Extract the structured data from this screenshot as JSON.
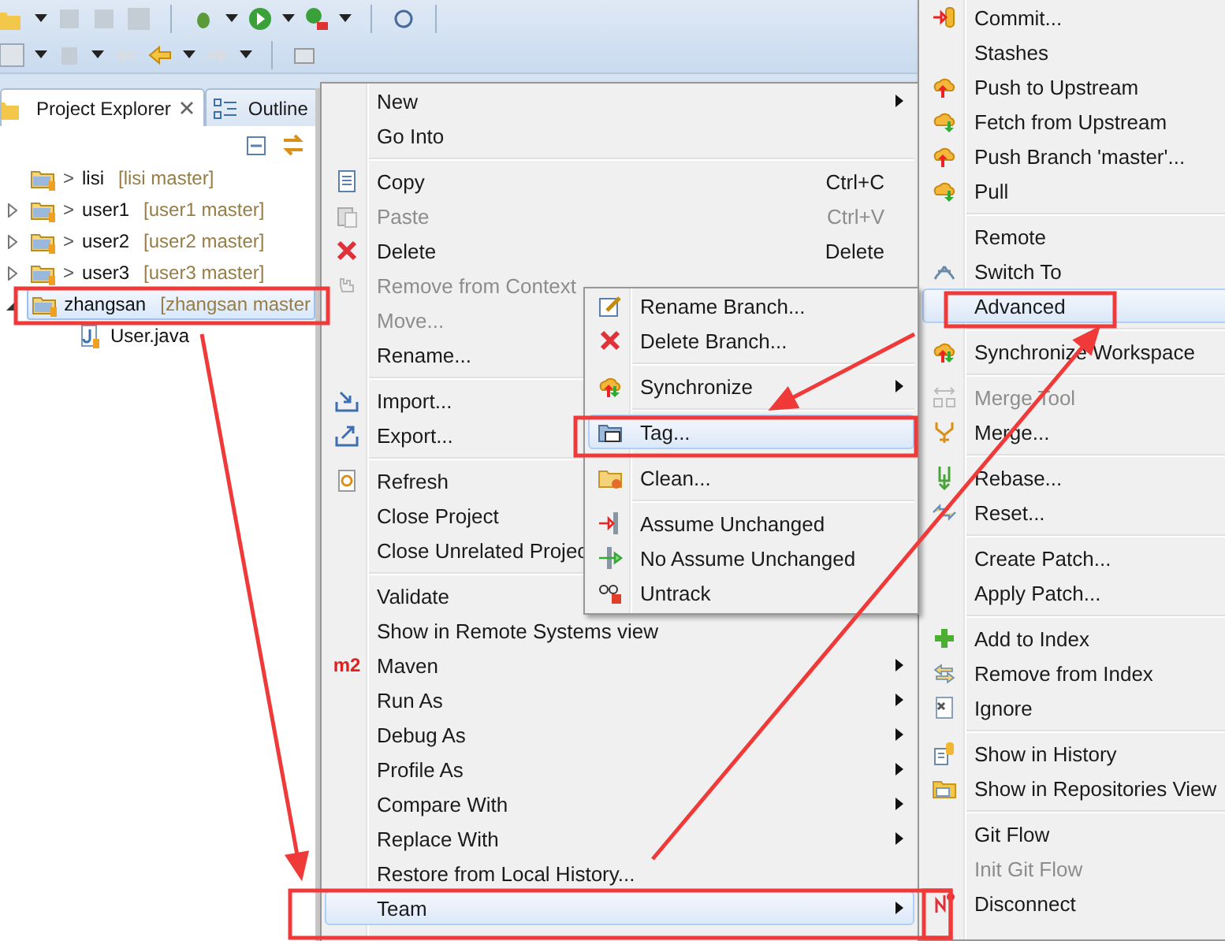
{
  "explorer": {
    "tabs": [
      {
        "label": "Project Explorer",
        "selected": true,
        "closable": true
      },
      {
        "label": "Outline",
        "selected": false
      }
    ],
    "tree": [
      {
        "mark": ">",
        "name": "lisi",
        "branch": "[lisi master]",
        "selected": false
      },
      {
        "mark": ">",
        "name": "user1",
        "branch": "[user1 master]",
        "expanded": false,
        "selected": false
      },
      {
        "mark": ">",
        "name": "user2",
        "branch": "[user2 master]",
        "expanded": false,
        "selected": false
      },
      {
        "mark": ">",
        "name": "user3",
        "branch": "[user3 master]",
        "expanded": false,
        "selected": false
      },
      {
        "name": "zhangsan",
        "branch": "[zhangsan master",
        "expanded": true,
        "selected": true,
        "children": [
          {
            "name": "User.java"
          }
        ]
      }
    ]
  },
  "context_menu": {
    "items": [
      {
        "kind": "item",
        "label": "New",
        "submenu": true,
        "disabled": false,
        "selected": false
      },
      {
        "kind": "item",
        "label": "Go Into",
        "submenu": false,
        "disabled": false,
        "selected": false
      },
      {
        "kind": "separator"
      },
      {
        "kind": "item",
        "label": "Copy",
        "shortcut": "Ctrl+C",
        "submenu": false,
        "disabled": false,
        "selected": false
      },
      {
        "kind": "item",
        "label": "Paste",
        "shortcut": "Ctrl+V",
        "submenu": false,
        "disabled": true,
        "selected": false
      },
      {
        "kind": "item",
        "label": "Delete",
        "shortcut": "Delete",
        "submenu": false,
        "disabled": false,
        "selected": false
      },
      {
        "kind": "item",
        "label": "Remove from Context",
        "disabled": true,
        "selected": false
      },
      {
        "kind": "item",
        "label": "Move...",
        "disabled": true,
        "selected": false
      },
      {
        "kind": "item",
        "label": "Rename...",
        "disabled": false,
        "selected": false
      },
      {
        "kind": "separator"
      },
      {
        "kind": "item",
        "label": "Import...",
        "disabled": false,
        "selected": false
      },
      {
        "kind": "item",
        "label": "Export...",
        "disabled": false,
        "selected": false
      },
      {
        "kind": "separator"
      },
      {
        "kind": "item",
        "label": "Refresh",
        "disabled": false,
        "selected": false
      },
      {
        "kind": "item",
        "label": "Close Project",
        "disabled": false,
        "selected": false
      },
      {
        "kind": "item",
        "label": "Close Unrelated Projec",
        "disabled": false,
        "selected": false
      },
      {
        "kind": "separator"
      },
      {
        "kind": "item",
        "label": "Validate",
        "disabled": false,
        "selected": false
      },
      {
        "kind": "item",
        "label": "Show in Remote Systems view",
        "submenu": false,
        "disabled": false,
        "selected": false
      },
      {
        "kind": "item",
        "label": "Maven",
        "badge": "m2",
        "submenu": true,
        "disabled": false,
        "selected": false
      },
      {
        "kind": "item",
        "label": "Run As",
        "submenu": true,
        "disabled": false,
        "selected": false
      },
      {
        "kind": "item",
        "label": "Debug As",
        "submenu": true,
        "disabled": false,
        "selected": false
      },
      {
        "kind": "item",
        "label": "Profile As",
        "submenu": true,
        "disabled": false,
        "selected": false
      },
      {
        "kind": "item",
        "label": "Compare With",
        "submenu": true,
        "disabled": false,
        "selected": false
      },
      {
        "kind": "item",
        "label": "Replace With",
        "submenu": true,
        "disabled": false,
        "selected": false
      },
      {
        "kind": "item",
        "label": "Restore from Local History...",
        "submenu": false,
        "disabled": false,
        "selected": false
      },
      {
        "kind": "item",
        "label": "Team",
        "submenu": true,
        "disabled": false,
        "selected": true
      }
    ]
  },
  "advanced_menu": {
    "items": [
      {
        "kind": "item",
        "label": "Rename Branch...",
        "submenu": false,
        "disabled": false,
        "selected": false
      },
      {
        "kind": "item",
        "label": "Delete Branch...",
        "submenu": false,
        "disabled": false,
        "selected": false
      },
      {
        "kind": "separator"
      },
      {
        "kind": "item",
        "label": "Synchronize",
        "submenu": true,
        "disabled": false,
        "selected": false
      },
      {
        "kind": "separator"
      },
      {
        "kind": "item",
        "label": "Tag...",
        "submenu": false,
        "disabled": false,
        "selected": true
      },
      {
        "kind": "separator"
      },
      {
        "kind": "item",
        "label": "Clean...",
        "submenu": false,
        "disabled": false,
        "selected": false
      },
      {
        "kind": "separator"
      },
      {
        "kind": "item",
        "label": "Assume Unchanged",
        "submenu": false,
        "disabled": false,
        "selected": false
      },
      {
        "kind": "item",
        "label": "No Assume Unchanged",
        "submenu": false,
        "disabled": false,
        "selected": false
      },
      {
        "kind": "item",
        "label": "Untrack",
        "submenu": false,
        "disabled": false,
        "selected": false
      }
    ]
  },
  "team_menu": {
    "items": [
      {
        "kind": "item",
        "label": "Commit...",
        "disabled": false,
        "selected": false
      },
      {
        "kind": "item",
        "label": "Stashes",
        "disabled": false,
        "selected": false
      },
      {
        "kind": "item",
        "label": "Push to Upstream",
        "disabled": false,
        "selected": false
      },
      {
        "kind": "item",
        "label": "Fetch from Upstream",
        "disabled": false,
        "selected": false
      },
      {
        "kind": "item",
        "label": "Push Branch 'master'...",
        "disabled": false,
        "selected": false
      },
      {
        "kind": "item",
        "label": "Pull",
        "disabled": false,
        "selected": false
      },
      {
        "kind": "separator"
      },
      {
        "kind": "item",
        "label": "Remote",
        "disabled": false,
        "selected": false
      },
      {
        "kind": "item",
        "label": "Switch To",
        "disabled": false,
        "selected": false
      },
      {
        "kind": "item",
        "label": "Advanced",
        "disabled": false,
        "selected": true
      },
      {
        "kind": "separator"
      },
      {
        "kind": "item",
        "label": "Synchronize Workspace",
        "disabled": false,
        "selected": false
      },
      {
        "kind": "separator"
      },
      {
        "kind": "item",
        "label": "Merge Tool",
        "disabled": true,
        "selected": false
      },
      {
        "kind": "item",
        "label": "Merge...",
        "disabled": false,
        "selected": false
      },
      {
        "kind": "separator"
      },
      {
        "kind": "item",
        "label": "Rebase...",
        "disabled": false,
        "selected": false
      },
      {
        "kind": "item",
        "label": "Reset...",
        "disabled": false,
        "selected": false
      },
      {
        "kind": "separator"
      },
      {
        "kind": "item",
        "label": "Create Patch...",
        "disabled": false,
        "selected": false
      },
      {
        "kind": "item",
        "label": "Apply Patch...",
        "disabled": false,
        "selected": false
      },
      {
        "kind": "separator"
      },
      {
        "kind": "item",
        "label": "Add to Index",
        "disabled": false,
        "selected": false
      },
      {
        "kind": "item",
        "label": "Remove from Index",
        "disabled": false,
        "selected": false
      },
      {
        "kind": "item",
        "label": "Ignore",
        "disabled": false,
        "selected": false
      },
      {
        "kind": "separator"
      },
      {
        "kind": "item",
        "label": "Show in History",
        "disabled": false,
        "selected": false
      },
      {
        "kind": "item",
        "label": "Show in Repositories View",
        "disabled": false,
        "selected": false
      },
      {
        "kind": "separator"
      },
      {
        "kind": "item",
        "label": "Git Flow",
        "disabled": false,
        "selected": false
      },
      {
        "kind": "item",
        "label": "Init Git Flow",
        "disabled": true,
        "selected": false
      },
      {
        "kind": "item",
        "label": "Disconnect",
        "disabled": false,
        "selected": false
      }
    ]
  }
}
